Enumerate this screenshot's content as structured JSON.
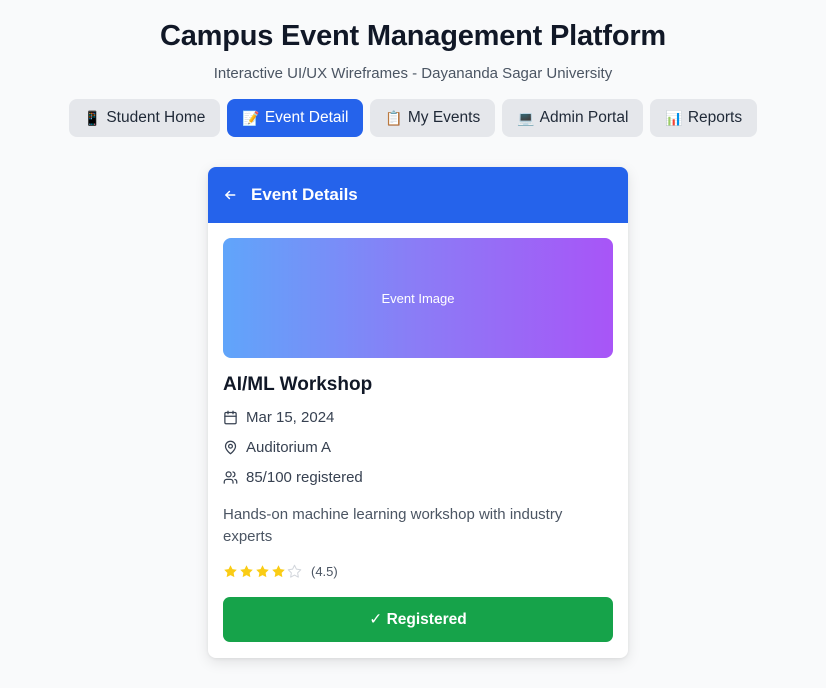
{
  "header": {
    "title": "Campus Event Management Platform",
    "subtitle": "Interactive UI/UX Wireframes - Dayananda Sagar University"
  },
  "tabs": [
    {
      "emoji": "📱",
      "label": "Student Home",
      "active": false
    },
    {
      "emoji": "📝",
      "label": "Event Detail",
      "active": true
    },
    {
      "emoji": "📋",
      "label": "My Events",
      "active": false
    },
    {
      "emoji": "💻",
      "label": "Admin Portal",
      "active": false
    },
    {
      "emoji": "📊",
      "label": "Reports",
      "active": false
    }
  ],
  "card": {
    "header_title": "Event Details",
    "back_icon": "arrow-left-icon",
    "image_placeholder": "Event Image",
    "event_name": "AI/ML Workshop",
    "date": "Mar 15, 2024",
    "location": "Auditorium A",
    "registered": "85/100 registered",
    "description": "Hands-on machine learning workshop with industry experts",
    "rating": {
      "stars": 4,
      "max_stars": 5,
      "label": "(4.5)"
    },
    "button_label": "✓ Registered"
  },
  "colors": {
    "primary": "#2563eb",
    "success": "#16a34a",
    "star": "#facc15",
    "gradient_start": "#60a5fa",
    "gradient_end": "#a855f7"
  }
}
